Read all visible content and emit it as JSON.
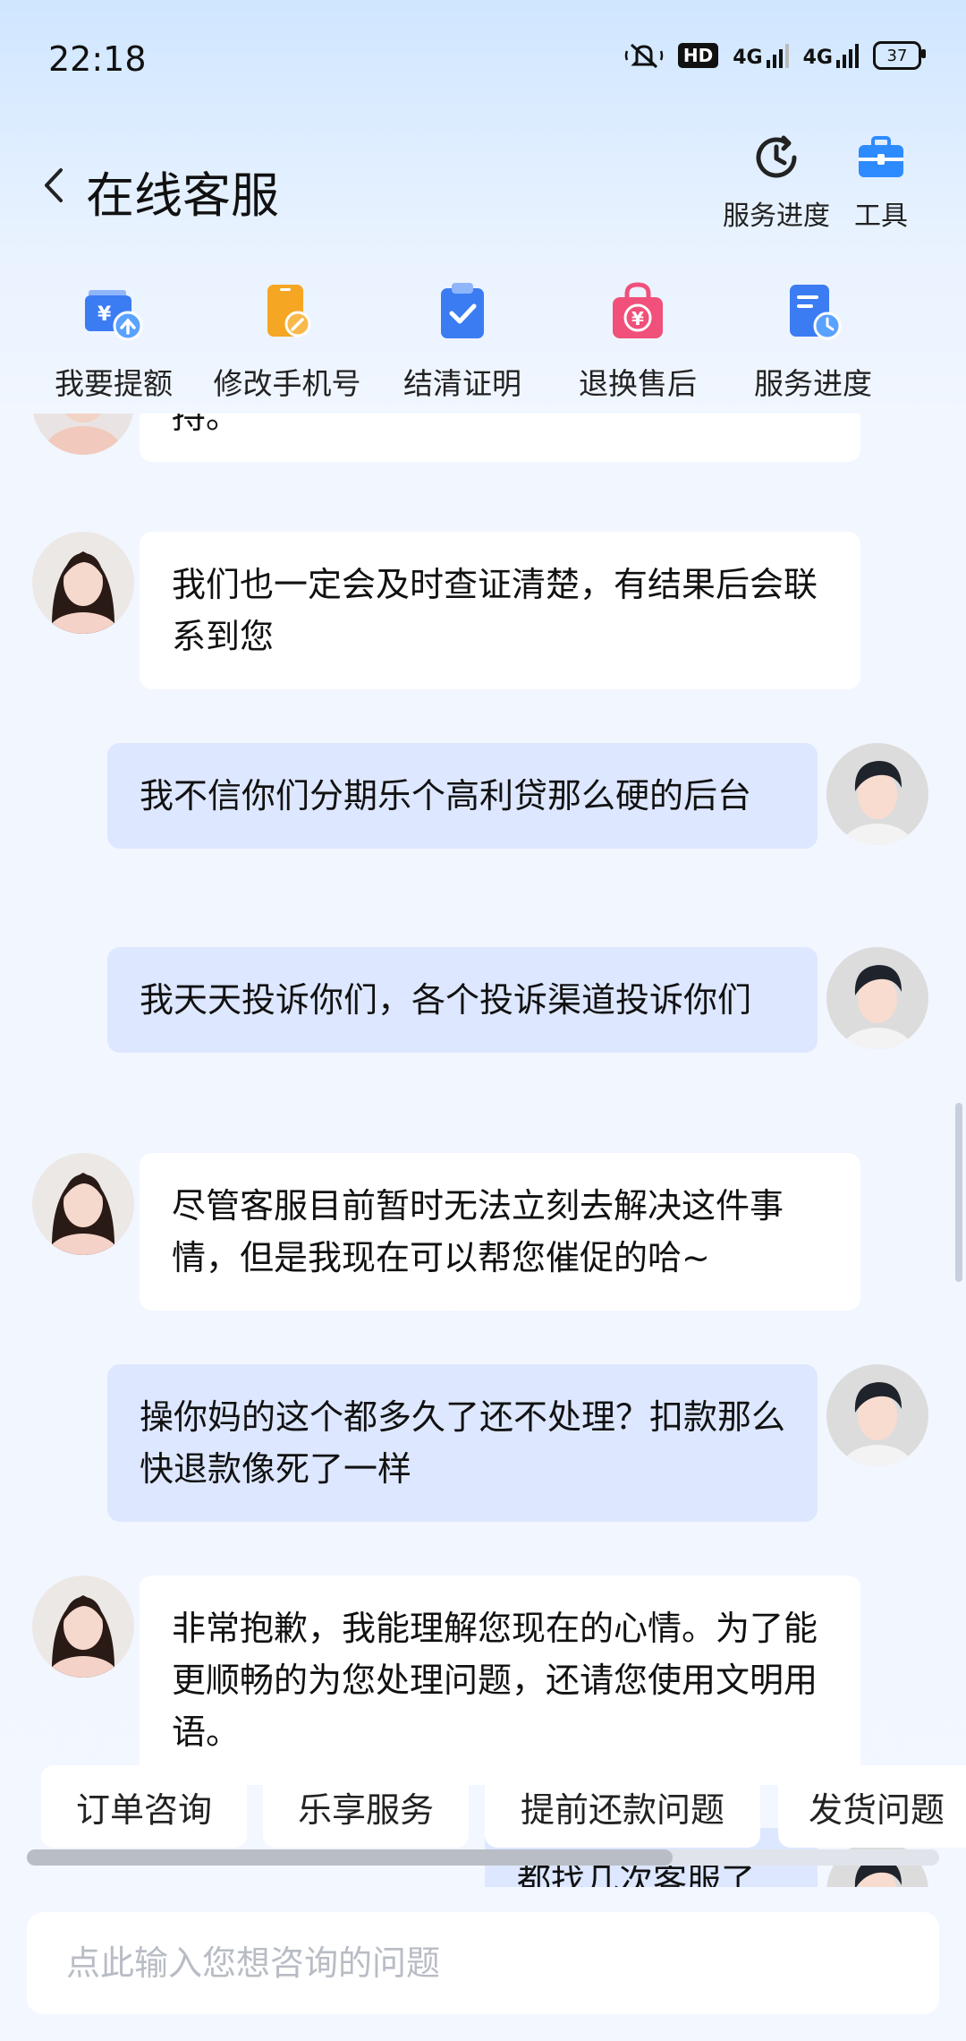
{
  "status_bar": {
    "time": "22:18",
    "hd_label": "HD",
    "net1": "4G",
    "net2": "4G",
    "battery": "37"
  },
  "header": {
    "title": "在线客服",
    "actions": [
      {
        "label": "服务进度",
        "icon": "clock-icon"
      },
      {
        "label": "工具",
        "icon": "toolbox-icon"
      }
    ]
  },
  "shortcuts": [
    {
      "label": "我要提额",
      "icon": "wallet-up-icon",
      "color": "#3b7cf2"
    },
    {
      "label": "修改手机号",
      "icon": "phone-edit-icon",
      "color": "#f5a623"
    },
    {
      "label": "结清证明",
      "icon": "clipboard-check-icon",
      "color": "#3b7cf2"
    },
    {
      "label": "退换售后",
      "icon": "shopping-bag-icon",
      "color": "#f0507a"
    },
    {
      "label": "服务进度",
      "icon": "document-clock-icon",
      "color": "#3b7cf2"
    }
  ],
  "messages": [
    {
      "from": "agent",
      "text": "持。"
    },
    {
      "from": "agent",
      "text": "我们也一定会及时查证清楚，有结果后会联系到您"
    },
    {
      "from": "user",
      "text": "我不信你们分期乐个高利贷那么硬的后台"
    },
    {
      "from": "user",
      "text": "我天天投诉你们，各个投诉渠道投诉你们"
    },
    {
      "from": "agent",
      "text": "尽管客服目前暂时无法立刻去解决这件事情，但是我现在可以帮您催促的哈~"
    },
    {
      "from": "user",
      "text": "操你妈的这个都多久了还不处理？扣款那么快退款像死了一样"
    },
    {
      "from": "agent",
      "text": "非常抱歉，我能理解您现在的心情。为了能更顺畅的为您处理问题，还请您使用文明用语。"
    },
    {
      "from": "user",
      "text": "都找几次客服了"
    }
  ],
  "quick_replies": [
    "订单咨询",
    "乐享服务",
    "提前还款问题",
    "发货问题"
  ],
  "input": {
    "placeholder": "点此输入您想咨询的问题",
    "value": ""
  }
}
